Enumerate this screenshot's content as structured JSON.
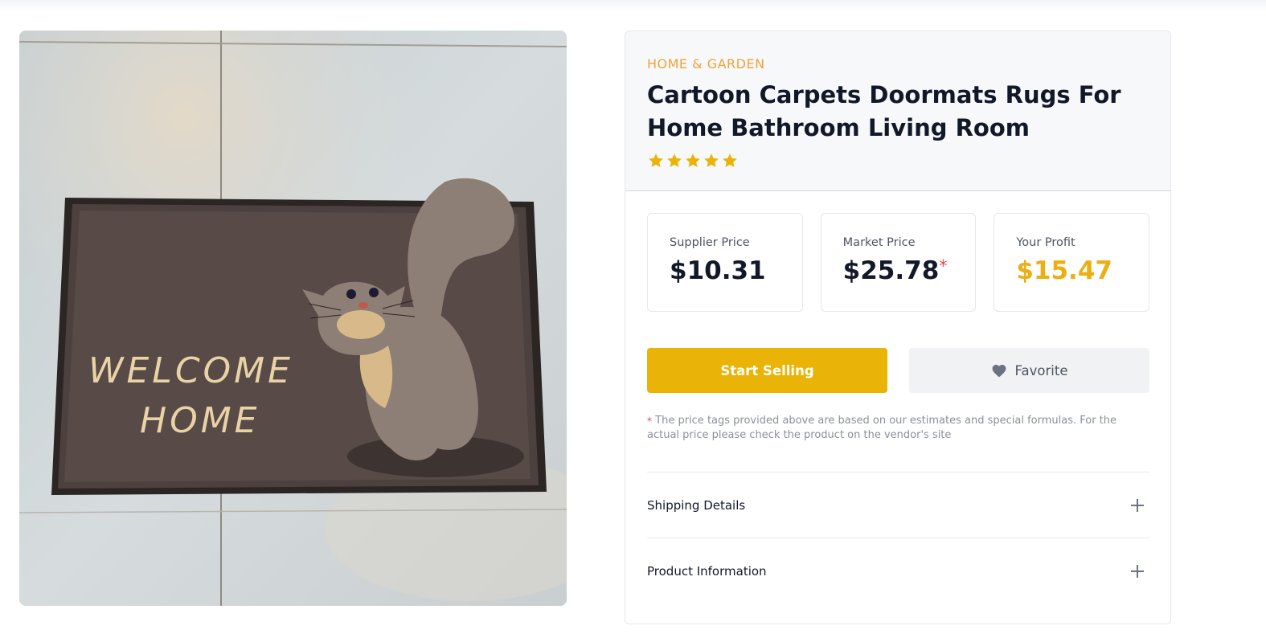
{
  "product": {
    "category": "HOME & GARDEN",
    "title": "Cartoon Carpets Doormats Rugs For Home Bathroom Living Room",
    "rating": 5,
    "rating_max": 5,
    "image": {
      "mat_text_line1": "WELCOME",
      "mat_text_line2": "HOME"
    }
  },
  "prices": {
    "supplier": {
      "label": "Supplier Price",
      "value": "$10.31"
    },
    "market": {
      "label": "Market Price",
      "value": "$25.78",
      "marker": "*"
    },
    "profit": {
      "label": "Your Profit",
      "value": "$15.47"
    }
  },
  "actions": {
    "start_selling": "Start Selling",
    "favorite": "Favorite",
    "favorite_icon": "heart-icon"
  },
  "note": {
    "marker": "*",
    "text": "The price tags provided above are based on our estimates and special formulas. For the actual price please check the product on the vendor's site"
  },
  "accordion": [
    {
      "label": "Shipping Details",
      "icon": "plus-icon"
    },
    {
      "label": "Product Information",
      "icon": "plus-icon"
    }
  ],
  "colors": {
    "accent": "#eab308",
    "category": "#eea23a",
    "profit": "#ecaf13",
    "marker": "#ef4444"
  }
}
